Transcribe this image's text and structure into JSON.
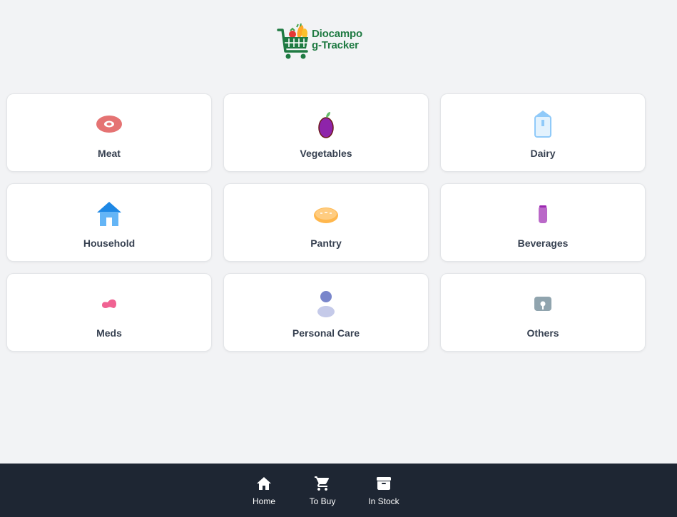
{
  "app": {
    "logo_line1": "Diocampo",
    "logo_line2": "g-Tracker",
    "brand_color": "#1f7a42"
  },
  "categories": [
    {
      "label": "Meat",
      "icon": "meat-icon",
      "color": "#e57373"
    },
    {
      "label": "Vegetables",
      "icon": "eggplant-icon",
      "color": "#8e24aa"
    },
    {
      "label": "Dairy",
      "icon": "milk-carton-icon",
      "color": "#90caf9"
    },
    {
      "label": "Household",
      "icon": "house-icon",
      "color": "#1e88e5"
    },
    {
      "label": "Pantry",
      "icon": "bread-icon",
      "color": "#ffb74d"
    },
    {
      "label": "Beverages",
      "icon": "can-icon",
      "color": "#ba68c8"
    },
    {
      "label": "Meds",
      "icon": "pill-icon",
      "color": "#f06292"
    },
    {
      "label": "Personal Care",
      "icon": "person-icon",
      "color": "#7986cb"
    },
    {
      "label": "Others",
      "icon": "box-icon",
      "color": "#90a4ae"
    }
  ],
  "nav": {
    "items": [
      {
        "label": "Home",
        "icon": "home-icon"
      },
      {
        "label": "To Buy",
        "icon": "shopping-cart-icon"
      },
      {
        "label": "In Stock",
        "icon": "archive-box-icon"
      }
    ],
    "background": "#1e2633"
  }
}
